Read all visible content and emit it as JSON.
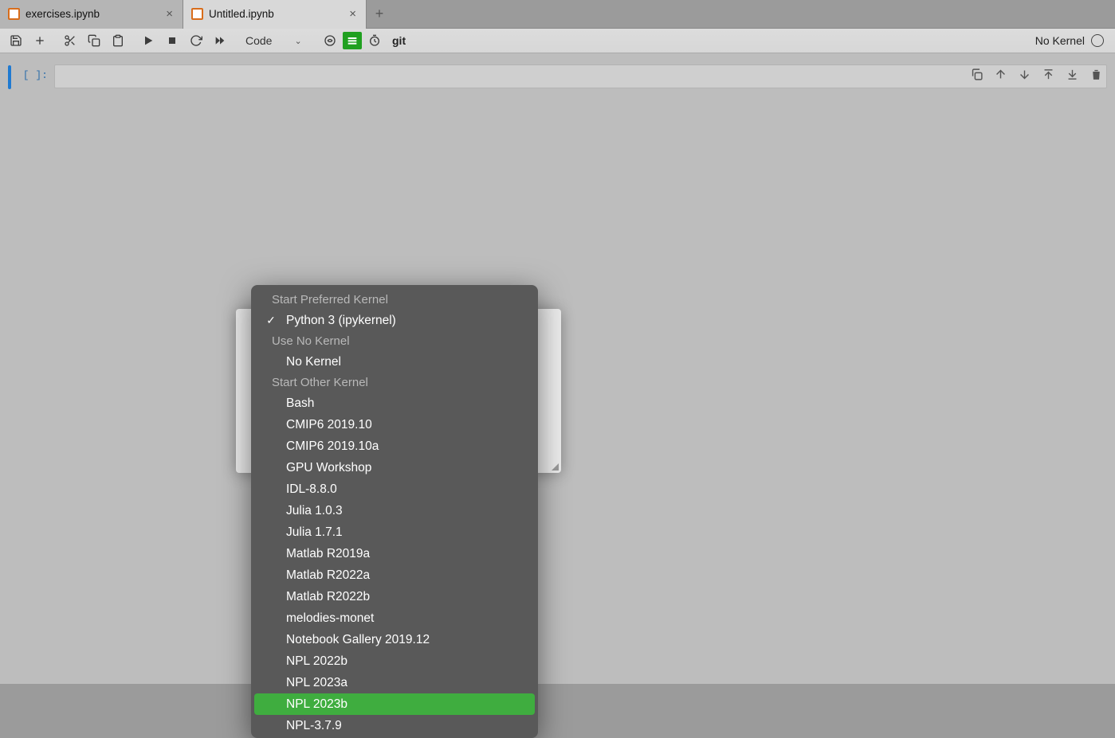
{
  "tabs": [
    {
      "label": "exercises.ipynb",
      "active": false
    },
    {
      "label": "Untitled.ipynb",
      "active": true
    }
  ],
  "toolbar": {
    "cell_type": "Code",
    "git_label": "git"
  },
  "status": {
    "kernel_label": "No Kernel"
  },
  "cell": {
    "prompt": "[ ]:"
  },
  "dropdown": {
    "section_preferred": "Start Preferred Kernel",
    "preferred": [
      {
        "label": "Python 3 (ipykernel)",
        "checked": true
      }
    ],
    "section_none": "Use No Kernel",
    "none": [
      {
        "label": "No Kernel"
      }
    ],
    "section_other": "Start Other Kernel",
    "other": [
      {
        "label": "Bash"
      },
      {
        "label": "CMIP6 2019.10"
      },
      {
        "label": "CMIP6 2019.10a"
      },
      {
        "label": "GPU Workshop"
      },
      {
        "label": "IDL-8.8.0"
      },
      {
        "label": "Julia 1.0.3"
      },
      {
        "label": "Julia 1.7.1"
      },
      {
        "label": "Matlab R2019a"
      },
      {
        "label": "Matlab R2022a"
      },
      {
        "label": "Matlab R2022b"
      },
      {
        "label": "melodies-monet"
      },
      {
        "label": "Notebook Gallery 2019.12"
      },
      {
        "label": "NPL 2022b"
      },
      {
        "label": "NPL 2023a"
      },
      {
        "label": "NPL 2023b",
        "highlight": true
      },
      {
        "label": "NPL-3.7.9"
      }
    ]
  }
}
